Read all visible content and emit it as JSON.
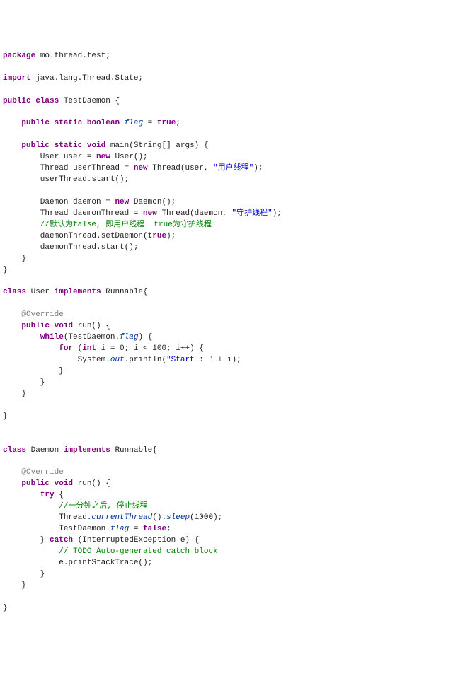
{
  "code": {
    "l1_kw_package": "package",
    "l1_pkg": " mo.thread.test;",
    "l3_kw_import": "import",
    "l3_imp": " java.lang.Thread.State;",
    "l5_kw_public": "public",
    "l5_kw_class": "class",
    "l5_name": " TestDaemon {",
    "l7_indent": "    ",
    "l7_kw_public": "public",
    "l7_kw_static": "static",
    "l7_kw_boolean": "boolean",
    "l7_field": "flag",
    "l7_eq": " = ",
    "l7_true": "true",
    "l7_semi": ";",
    "l9_kw_public": "public",
    "l9_kw_static": "static",
    "l9_kw_void": "void",
    "l9_sig": " main(String[] args) {",
    "l10_txt_a": "        User user = ",
    "l10_kw_new": "new",
    "l10_txt_b": " User();",
    "l11_txt_a": "        Thread userThread = ",
    "l11_kw_new": "new",
    "l11_txt_b": " Thread(user, ",
    "l11_str": "\"用户线程\"",
    "l11_txt_c": ");",
    "l12": "        userThread.start();",
    "l14_txt_a": "        Daemon daemon = ",
    "l14_kw_new": "new",
    "l14_txt_b": " Daemon();",
    "l15_txt_a": "        Thread daemonThread = ",
    "l15_kw_new": "new",
    "l15_txt_b": " Thread(daemon, ",
    "l15_str": "\"守护线程\"",
    "l15_txt_c": ");",
    "l16_cmt": "        //默认为false, 即用户线程. true为守护线程",
    "l17_txt_a": "        daemonThread.setDaemon(",
    "l17_true": "true",
    "l17_txt_b": ");",
    "l18": "        daemonThread.start();",
    "l19": "    }",
    "l20": "}",
    "l22_kw_class": "class",
    "l22_name_a": " User ",
    "l22_kw_impl": "implements",
    "l22_name_b": " Runnable{",
    "l24_ann": "    @Override",
    "l25_kw_public": "public",
    "l25_kw_void": "void",
    "l25_sig": " run() {",
    "l26_kw_while": "while",
    "l26_a": "(TestDaemon.",
    "l26_field": "flag",
    "l26_b": ") {",
    "l27_kw_for": "for",
    "l27_a": " (",
    "l27_kw_int": "int",
    "l27_b": " i = 0; i < 100; i++) {",
    "l28_a": "                System.",
    "l28_out": "out",
    "l28_b": ".println(",
    "l28_str": "\"Start : \"",
    "l28_c": " + i);",
    "l29": "            }",
    "l30": "        }",
    "l31": "    }",
    "l33": "}",
    "l36_kw_class": "class",
    "l36_a": " Daemon ",
    "l36_kw_impl": "implements",
    "l36_b": " Runnable{",
    "l38_ann": "    @Override",
    "l39_kw_public": "public",
    "l39_kw_void": "void",
    "l39_sig": " run() {",
    "l40_kw_try": "try",
    "l40_b": " {",
    "l41_cmt": "            //一分钟之后, 停止线程",
    "l42_a": "            Thread.",
    "l42_m": "currentThread",
    "l42_b": "().",
    "l42_m2": "sleep",
    "l42_c": "(1000);",
    "l43_a": "            TestDaemon.",
    "l43_field": "flag",
    "l43_b": " = ",
    "l43_false": "false",
    "l43_c": ";",
    "l44_a": "        } ",
    "l44_kw_catch": "catch",
    "l44_b": " (InterruptedException e) {",
    "l45_cmt": "            // TODO Auto-generated catch block",
    "l46": "            e.printStackTrace();",
    "l47": "        }",
    "l48": "    }",
    "l50": "}"
  }
}
